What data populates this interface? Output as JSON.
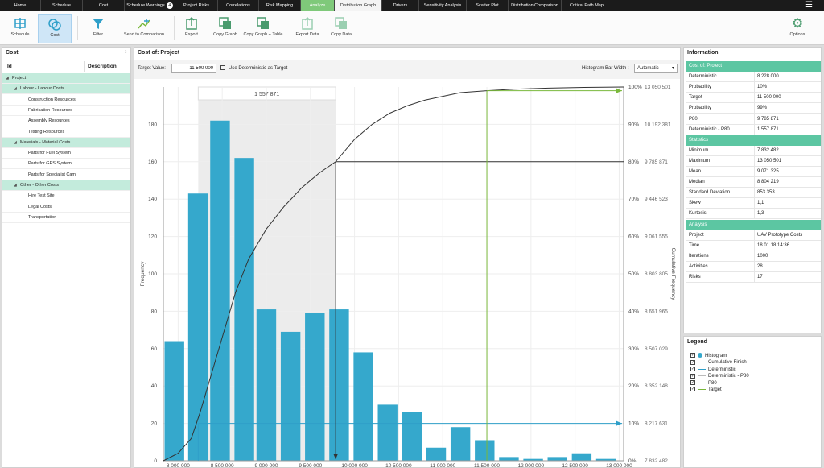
{
  "tabs": [
    {
      "label": "Home"
    },
    {
      "label": "Schedule"
    },
    {
      "label": "Cost"
    },
    {
      "label": "Schedule Warnings",
      "badge": "4"
    },
    {
      "label": "Project Risks"
    },
    {
      "label": "Correlations"
    },
    {
      "label": "Risk Mapping"
    },
    {
      "label": "Analyze",
      "active": true
    },
    {
      "label": "Distribution Graph",
      "current": true
    },
    {
      "label": "Drivers"
    },
    {
      "label": "Sensitivity Analysis"
    },
    {
      "label": "Scatter Plot"
    },
    {
      "label": "Distribution Comparison"
    },
    {
      "label": "Critical Path Map"
    }
  ],
  "toolbar": {
    "schedule": "Schedule",
    "cost": "Cost",
    "filter": "Filter",
    "send": "Send to Comparison",
    "export": "Export",
    "copy_graph": "Copy Graph",
    "copy_graph_table": "Copy Graph + Table",
    "export_data": "Export Data",
    "copy_data": "Copy Data",
    "options": "Options"
  },
  "left": {
    "title": "Cost",
    "col_id": "Id",
    "col_desc": "Description",
    "rows": [
      {
        "label": "Project",
        "level": 0,
        "group": true
      },
      {
        "label": "Labour - Labour Costs",
        "level": 1,
        "group": true
      },
      {
        "label": "Construction Resources",
        "level": 2
      },
      {
        "label": "Fabrication Resources",
        "level": 2
      },
      {
        "label": "Assembly Resources",
        "level": 2
      },
      {
        "label": "Testing Resources",
        "level": 2
      },
      {
        "label": "Materials - Material Costs",
        "level": 1,
        "group": true
      },
      {
        "label": "Parts for Fuel System",
        "level": 2
      },
      {
        "label": "Parts for GPS System",
        "level": 2
      },
      {
        "label": "Parts for Specialist Cam",
        "level": 2
      },
      {
        "label": "Other - Other Costs",
        "level": 1,
        "group": true
      },
      {
        "label": "Hire Test Site",
        "level": 2
      },
      {
        "label": "Legal Costs",
        "level": 2
      },
      {
        "label": "Transportation",
        "level": 2
      }
    ]
  },
  "center": {
    "title": "Cost of: Project",
    "target_label": "Target Value:",
    "target_value": "11 500 000",
    "use_det_label": "Use Deterministic as Target",
    "bar_width_label": "Histogram Bar Width :",
    "bar_width_value": "Automatic",
    "range_label": "1 557 871"
  },
  "chart_data": {
    "type": "bar",
    "ylabel": "Frequency",
    "y2label": "Cumulative Frequency",
    "ylim": [
      0,
      200
    ],
    "yticks": [
      "0",
      "20",
      "40",
      "60",
      "80",
      "100",
      "120",
      "140",
      "160",
      "180"
    ],
    "xticks": [
      "8 000 000",
      "8 500 000",
      "9 000 000",
      "9 500 000",
      "10 000 000",
      "10 500 000",
      "11 000 000",
      "11 500 000",
      "12 000 000",
      "12 500 000",
      "13 000 000"
    ],
    "xtick_values": [
      8000000,
      8500000,
      9000000,
      9500000,
      10000000,
      10500000,
      11000000,
      11500000,
      12000000,
      12500000,
      13000000
    ],
    "xlim": [
      7832482,
      13050501
    ],
    "bin_starts": [
      7832482,
      8100000,
      8350000,
      8625000,
      8875000,
      9150000,
      9425000,
      9700000,
      9975000,
      10250000,
      10525000,
      10800000,
      11075000,
      11350000,
      11625000,
      11900000,
      12175000,
      12450000,
      12725000
    ],
    "bin_width": 250000,
    "values": [
      64,
      143,
      182,
      162,
      81,
      69,
      79,
      81,
      58,
      30,
      26,
      7,
      18,
      11,
      2,
      1,
      2,
      4,
      1
    ],
    "cum_ticks": [
      {
        "pct": "0%",
        "val": "7 832 482"
      },
      {
        "pct": "10%",
        "val": "8 217 631"
      },
      {
        "pct": "20%",
        "val": "8 352 148"
      },
      {
        "pct": "30%",
        "val": "8 507 029"
      },
      {
        "pct": "40%",
        "val": "8 651 965"
      },
      {
        "pct": "50%",
        "val": "8 803 805"
      },
      {
        "pct": "60%",
        "val": "9 061 555"
      },
      {
        "pct": "70%",
        "val": "9 446 523"
      },
      {
        "pct": "80%",
        "val": "9 785 871"
      },
      {
        "pct": "90%",
        "val": "10 192 381"
      },
      {
        "pct": "100%",
        "val": "13 050 501"
      }
    ],
    "cumulative_x": [
      7832482,
      8000000,
      8150000,
      8250000,
      8400000,
      8500000,
      8650000,
      8800000,
      9000000,
      9200000,
      9400000,
      9600000,
      9785871,
      10000000,
      10200000,
      10400000,
      10600000,
      10800000,
      11000000,
      11200000,
      11500000,
      11800000,
      12200000,
      12600000,
      13050501
    ],
    "cumulative_y": [
      0,
      0.02,
      0.06,
      0.13,
      0.25,
      0.33,
      0.45,
      0.54,
      0.62,
      0.68,
      0.73,
      0.77,
      0.8,
      0.86,
      0.9,
      0.93,
      0.95,
      0.965,
      0.975,
      0.985,
      0.99,
      0.994,
      0.997,
      0.999,
      1.0
    ],
    "colors": {
      "bar": "#35a8cc",
      "cum": "#333333",
      "det": "#2f9fc9",
      "p80": "#333333",
      "target": "#7ab83b"
    },
    "deterministic": 8228000,
    "p80_x": 9785871,
    "p80_y": 0.8,
    "target": 11500000,
    "target_prob": 0.99
  },
  "info": {
    "title": "Information",
    "rows": [
      {
        "k": "Cost of: Project",
        "h": true
      },
      {
        "k": "Deterministic",
        "v": "8 228 000"
      },
      {
        "k": "Probability",
        "v": "10%"
      },
      {
        "k": "Target",
        "v": "11 500 000"
      },
      {
        "k": "Probability",
        "v": "99%"
      },
      {
        "k": "P80",
        "v": "9 785 871"
      },
      {
        "k": "Deterministic - P80",
        "v": "1 557 871"
      },
      {
        "k": "Statistics",
        "h": true
      },
      {
        "k": "Minimum",
        "v": "7 832 482"
      },
      {
        "k": "Maximum",
        "v": "13 050 501"
      },
      {
        "k": "Mean",
        "v": "9 071 325"
      },
      {
        "k": "Median",
        "v": "8 804 219"
      },
      {
        "k": "Standard Deviation",
        "v": "853 353"
      },
      {
        "k": "Skew",
        "v": "1,1"
      },
      {
        "k": "Kurtosis",
        "v": "1,3"
      },
      {
        "k": "Analysis",
        "h": true
      },
      {
        "k": "Project",
        "v": "UAV Prototype Costs"
      },
      {
        "k": "Time",
        "v": "18.01.18 14:36"
      },
      {
        "k": "Iterations",
        "v": "1000"
      },
      {
        "k": "Activities",
        "v": "28"
      },
      {
        "k": "Risks",
        "v": "17"
      }
    ]
  },
  "legend": {
    "title": "Legend",
    "items": [
      {
        "label": "Histogram",
        "color": "#35a8cc",
        "kind": "dot"
      },
      {
        "label": "Cumulative Finish",
        "color": "#888888",
        "kind": "line"
      },
      {
        "label": "Deterministic",
        "color": "#2f9fc9",
        "kind": "line"
      },
      {
        "label": "Deterministic - P80",
        "color": "#bbbbbb",
        "kind": "line"
      },
      {
        "label": "P80",
        "color": "#333333",
        "kind": "line"
      },
      {
        "label": "Target",
        "color": "#7ab83b",
        "kind": "line"
      }
    ]
  }
}
